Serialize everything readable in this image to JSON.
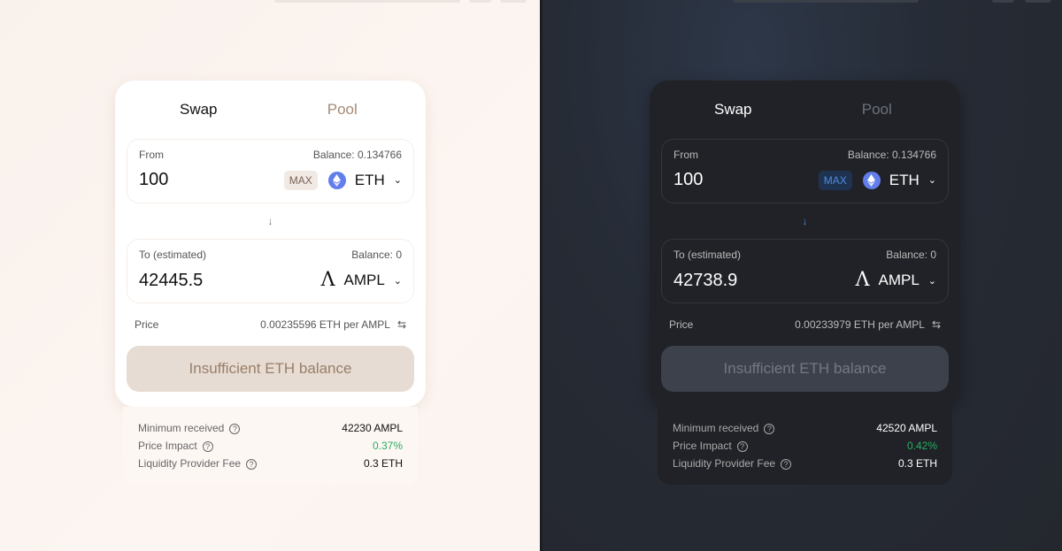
{
  "colors": {
    "accent_light": "#a58a74",
    "accent_dark": "#4c8be0",
    "eth": "#627eea",
    "positive": "#27ae60"
  },
  "panels": {
    "light": {
      "tabs": [
        "Swap",
        "Pool"
      ],
      "from": {
        "label": "From",
        "balance": "Balance: 0.134766",
        "amount": "100",
        "max": "MAX",
        "token": "ETH",
        "token_icon": "ethereum-icon"
      },
      "to": {
        "label": "To (estimated)",
        "balance": "Balance: 0",
        "amount": "42445.5",
        "token": "AMPL",
        "token_icon": "ampleforth-lambda-icon"
      },
      "price": {
        "label": "Price",
        "value": "0.00235596 ETH per AMPL"
      },
      "button": "Insufficient ETH balance",
      "details": [
        {
          "label": "Minimum received",
          "value": "42230 AMPL"
        },
        {
          "label": "Price Impact",
          "value": "0.37%"
        },
        {
          "label": "Liquidity Provider Fee",
          "value": "0.3 ETH"
        }
      ]
    },
    "dark": {
      "tabs": [
        "Swap",
        "Pool"
      ],
      "from": {
        "label": "From",
        "balance": "Balance: 0.134766",
        "amount": "100",
        "max": "MAX",
        "token": "ETH",
        "token_icon": "ethereum-icon"
      },
      "to": {
        "label": "To (estimated)",
        "balance": "Balance: 0",
        "amount": "42738.9",
        "token": "AMPL",
        "token_icon": "ampleforth-lambda-icon"
      },
      "price": {
        "label": "Price",
        "value": "0.00233979 ETH per AMPL"
      },
      "button": "Insufficient ETH balance",
      "details": [
        {
          "label": "Minimum received",
          "value": "42520 AMPL"
        },
        {
          "label": "Price Impact",
          "value": "0.42%"
        },
        {
          "label": "Liquidity Provider Fee",
          "value": "0.3 ETH"
        }
      ]
    }
  }
}
